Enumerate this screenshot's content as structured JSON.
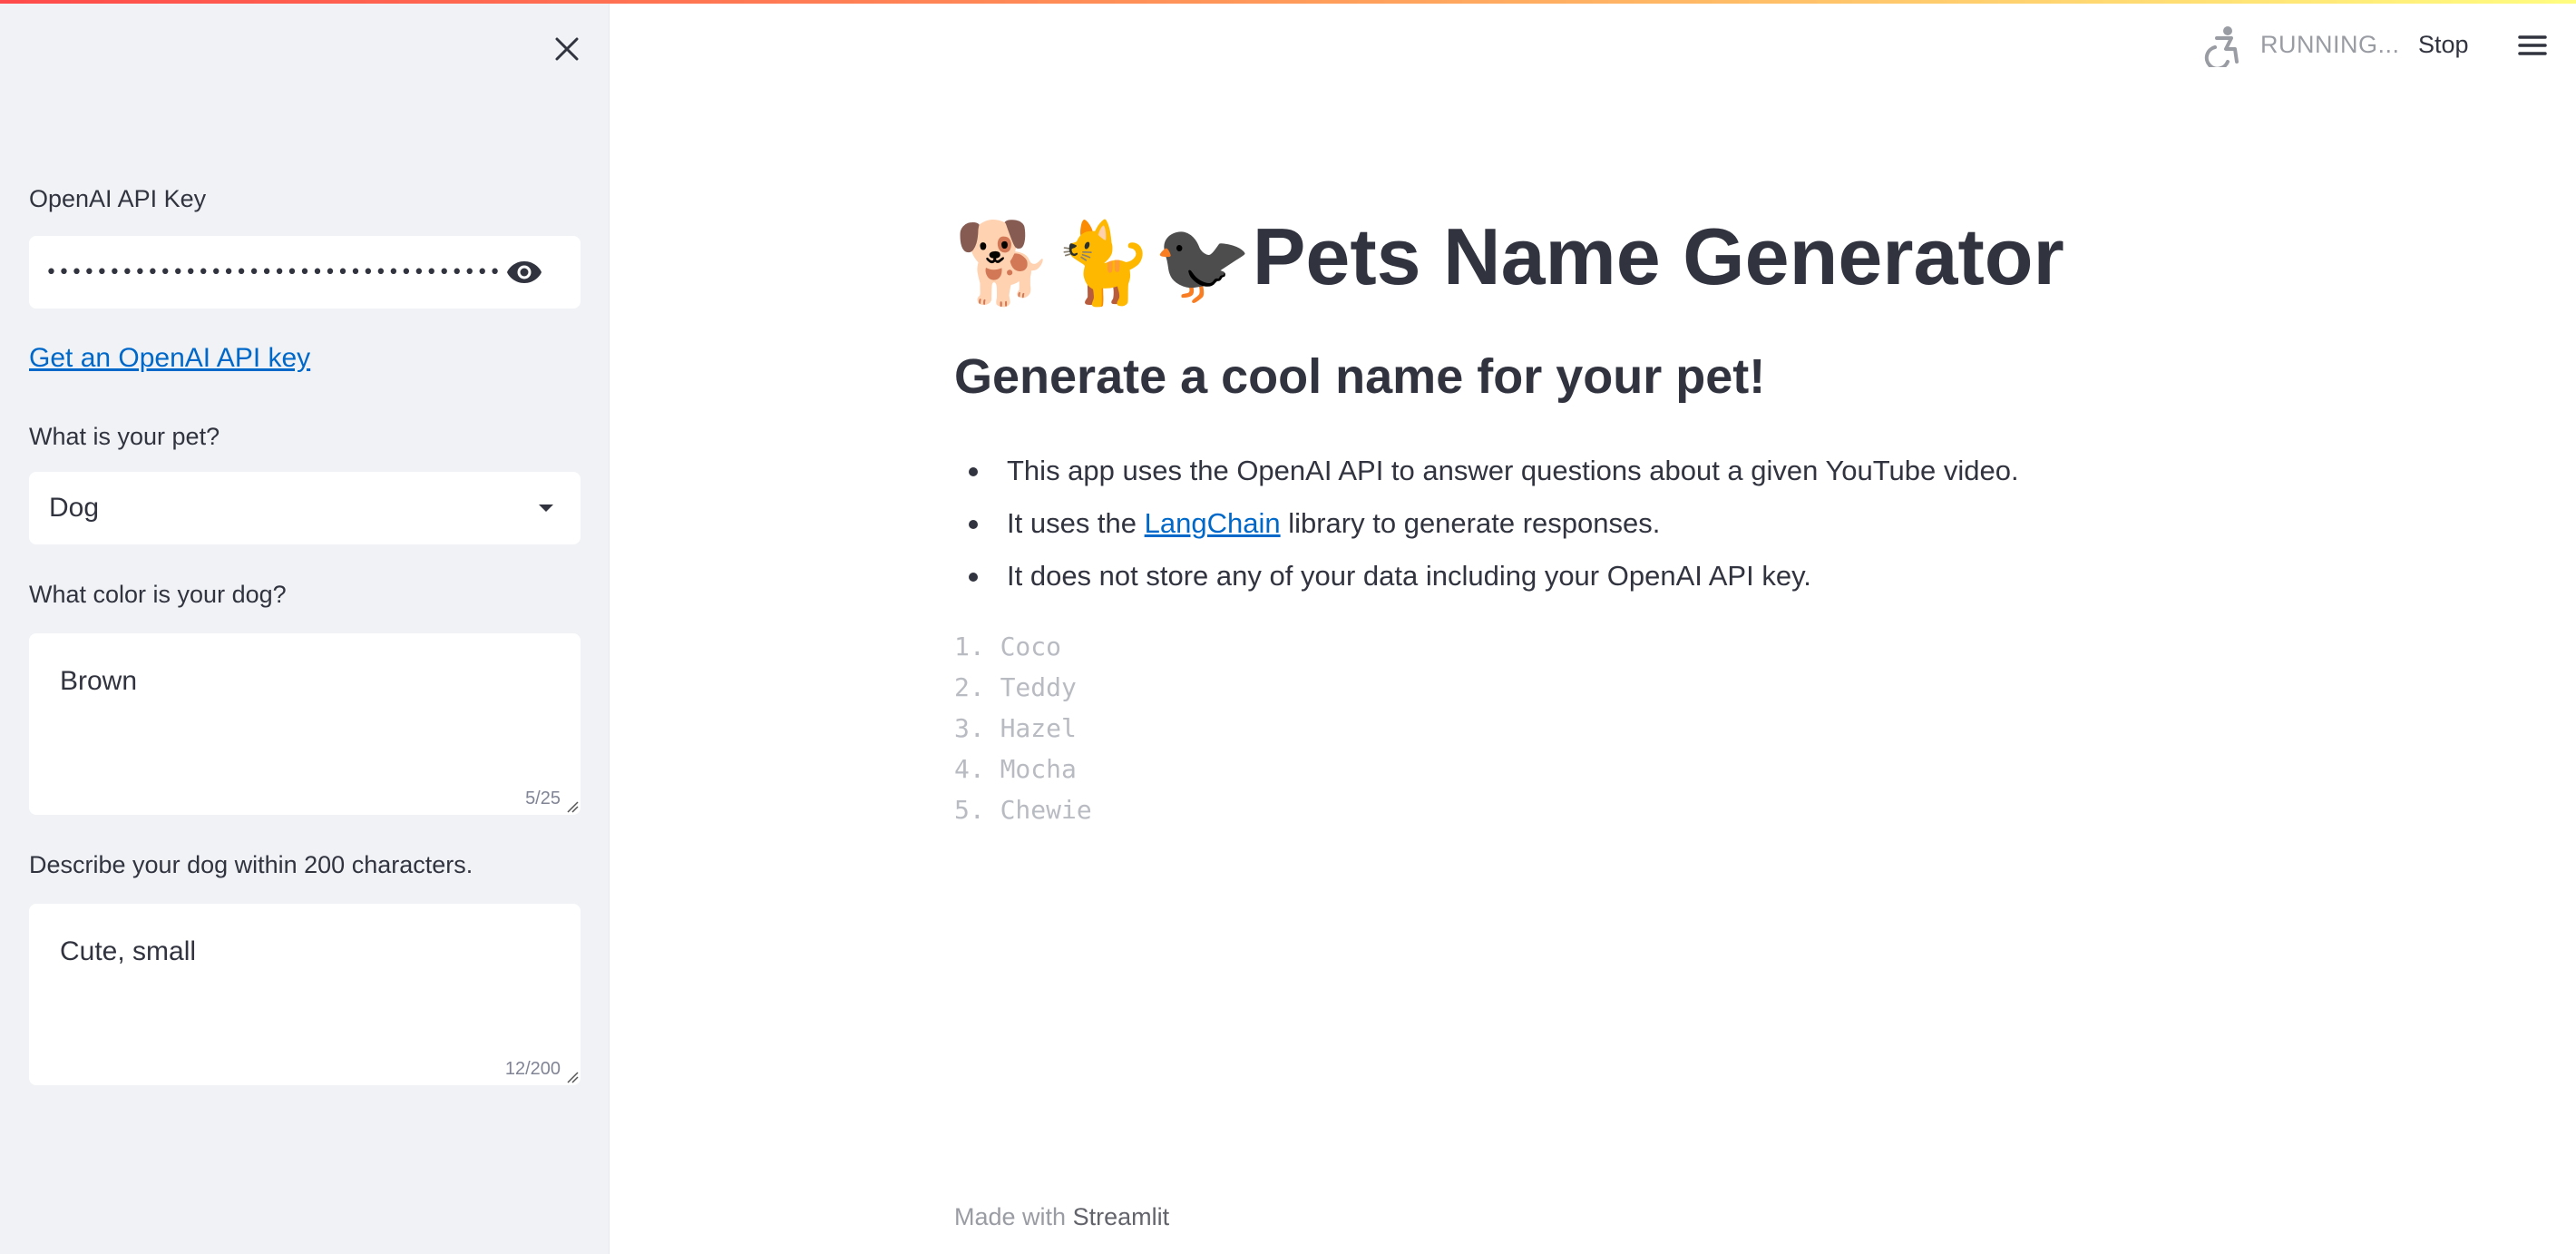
{
  "header": {
    "status": "RUNNING...",
    "stop_label": "Stop"
  },
  "sidebar": {
    "api_key": {
      "label": "OpenAI API Key",
      "value": "••••••••••••••••••••••••••••••••••••••••••••••••••••••••"
    },
    "api_link": "Get an OpenAI API key",
    "pet_select": {
      "label": "What is your pet?",
      "value": "Dog"
    },
    "color_field": {
      "label": "What color is your dog?",
      "value": "Brown",
      "counter": "5/25"
    },
    "describe_field": {
      "label": "Describe your dog within 200 characters.",
      "value": "Cute, small",
      "counter": "12/200"
    }
  },
  "main": {
    "title_emojis": "🐕🐈🐦‍⬛",
    "title": "Pets Name Generator",
    "subtitle": "Generate a cool name for your pet!",
    "bullets": {
      "b1": "This app uses the OpenAI API to answer questions about a given YouTube video.",
      "b2_prefix": "It uses the ",
      "b2_link": "LangChain",
      "b2_suffix": " library to generate responses.",
      "b3": "It does not store any of your data including your OpenAI API key."
    },
    "names": [
      "1. Coco",
      "2. Teddy",
      "3. Hazel",
      "4. Mocha",
      "5. Chewie"
    ]
  },
  "footer": {
    "prefix": "Made with ",
    "brand": "Streamlit"
  },
  "colors": {
    "link": "#0068c9",
    "sidebar_bg": "#f0f2f6",
    "text": "#31333f",
    "accent_gradient_start": "#ff4b4b",
    "accent_gradient_end": "#fffd80"
  },
  "icons": [
    "close-icon",
    "eye-icon",
    "chevron-down-icon",
    "running-accessibility-icon",
    "hamburger-menu-icon"
  ]
}
